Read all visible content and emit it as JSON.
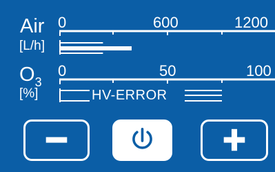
{
  "air": {
    "label": "Air",
    "unit": "[L/h]",
    "ticks": [
      "0",
      "600",
      "1200"
    ],
    "scale_max": 1200,
    "bar_values": [
      400,
      240,
      240
    ]
  },
  "ozone": {
    "label_main": "O",
    "label_sub": "3",
    "unit": "[%]",
    "ticks": [
      "0",
      "50",
      "100"
    ],
    "error_text": "HV-ERROR"
  },
  "controls": {
    "minus": "minus-icon",
    "power": "power-icon",
    "plus": "plus-icon"
  },
  "colors": {
    "background": "#0b5ea6",
    "foreground": "#ffffff"
  }
}
